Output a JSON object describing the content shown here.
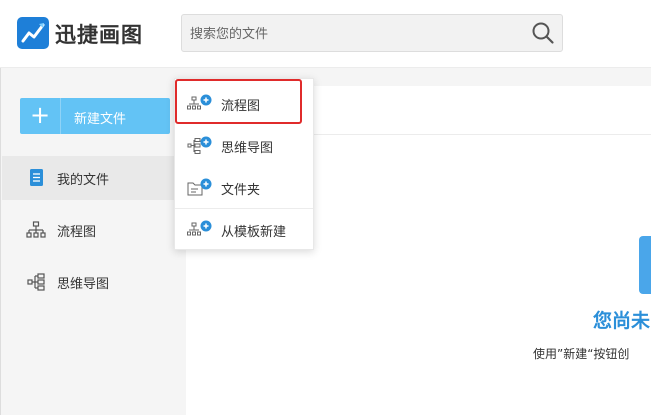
{
  "header": {
    "brand": "迅捷画图",
    "search": {
      "placeholder": "搜索您的文件"
    }
  },
  "sidebar": {
    "new_button_label": "新建文件",
    "items": [
      {
        "label": "我的文件",
        "icon": "document-icon",
        "active": true
      },
      {
        "label": "流程图",
        "icon": "flowchart-icon"
      },
      {
        "label": "思维导图",
        "icon": "mindmap-icon"
      }
    ]
  },
  "dropdown": {
    "items": [
      {
        "label": "流程图",
        "icon": "flowchart-add-icon"
      },
      {
        "label": "思维导图",
        "icon": "mindmap-add-icon"
      },
      {
        "label": "文件夹",
        "icon": "folder-add-icon"
      },
      {
        "label": "从模板新建",
        "icon": "template-add-icon"
      }
    ]
  },
  "empty_state": {
    "title": "您尚未",
    "hint": "使用”新建“按钮创"
  },
  "colors": {
    "accent": "#2b8fd9",
    "new_button": "#63c3f5",
    "highlight": "#e02b2b",
    "sidebar_bg": "#f5f5f5"
  }
}
